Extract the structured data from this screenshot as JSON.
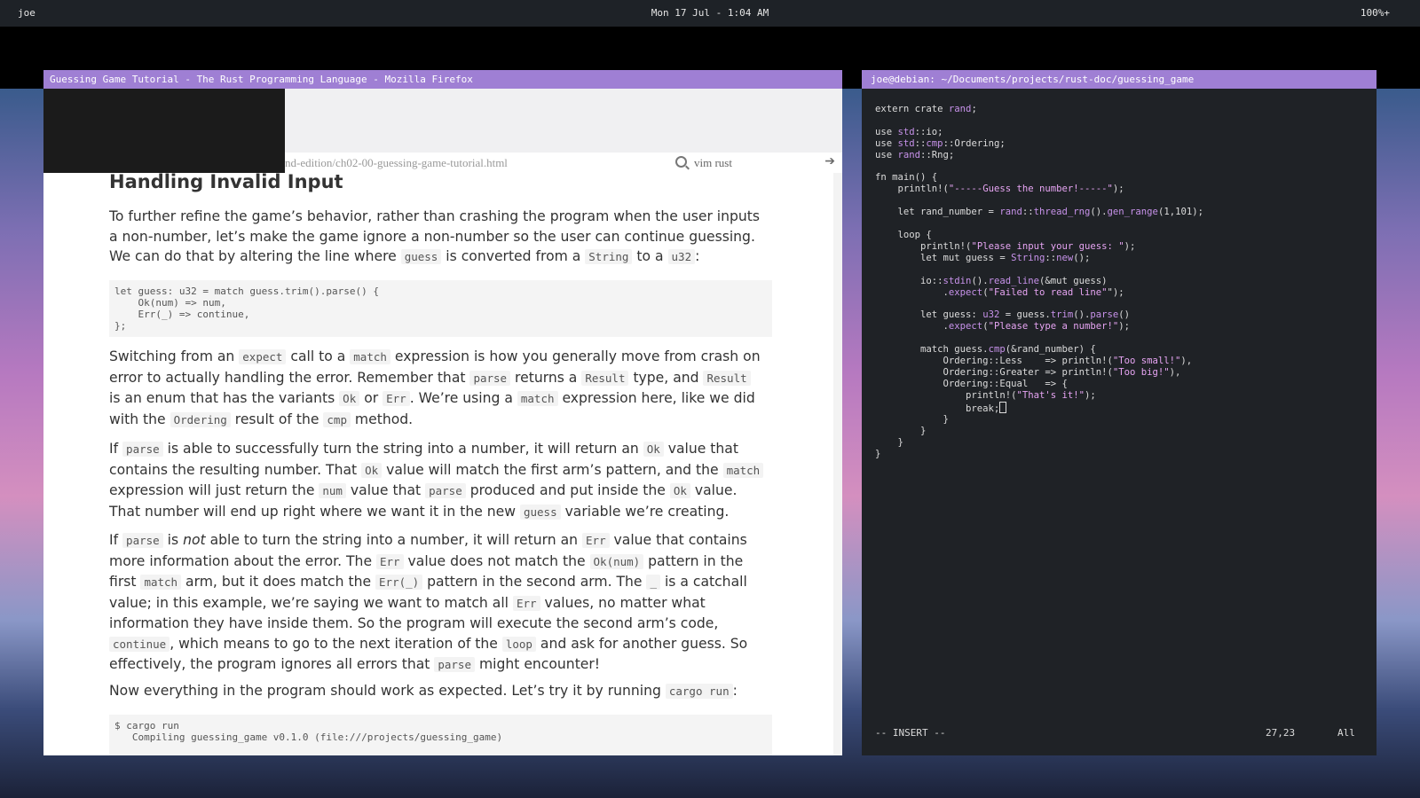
{
  "topbar": {
    "user": "joe",
    "clock": "Mon 17 Jul -  1:04 AM",
    "battery": "100%+"
  },
  "firefox": {
    "title": "Guessing Game Tutorial - The Rust Programming Language - Mozilla Firefox",
    "url_partial": "nd-edition/ch02-00-guessing-game-tutorial.html",
    "search_value": "vim rust",
    "go_glyph": "➔"
  },
  "article": {
    "heading": "Handling Invalid Input",
    "p1": [
      "To further refine the game’s behavior, rather than crashing the program when the user inputs a non-number, let’s make the game ignore a non-number so the user can continue guessing. We can do that by altering the line where ",
      "guess",
      " is converted from a ",
      "String",
      " to a ",
      "u32",
      ":"
    ],
    "code1": [
      "let guess: u32 = match guess.trim().parse() {",
      "    Ok(num) => num,",
      "    Err(_) => continue,",
      "};"
    ],
    "p2": [
      "Switching from an ",
      "expect",
      " call to a ",
      "match",
      " expression is how you generally move from crash on error to actually handling the error. Remember that ",
      "parse",
      " returns a ",
      "Result",
      " type, and ",
      "Result",
      " is an enum that has the variants ",
      "Ok",
      " or ",
      "Err",
      ". We’re using a ",
      "match",
      " expression here, like we did with the ",
      "Ordering",
      " result of the ",
      "cmp",
      " method."
    ],
    "p3": [
      "If ",
      "parse",
      " is able to successfully turn the string into a number, it will return an ",
      "Ok",
      " value that contains the resulting number. That ",
      "Ok",
      " value will match the first arm’s pattern, and the ",
      "match",
      " expression will just return the ",
      "num",
      " value that ",
      "parse",
      " produced and put inside the ",
      "Ok",
      " value. That number will end up right where we want it in the new ",
      "guess",
      " variable we’re creating."
    ],
    "p4": [
      "If ",
      "parse",
      " is ",
      "not",
      " able to turn the string into a number, it will return an ",
      "Err",
      " value that contains more information about the error. The ",
      "Err",
      " value does not match the ",
      "Ok(num)",
      " pattern in the first ",
      "match",
      " arm, but it does match the ",
      "Err(_)",
      " pattern in the second arm. The ",
      "_",
      " is a catchall value; in this example, we’re saying we want to match all ",
      "Err",
      " values, no matter what information they have inside them. So the program will execute the second arm’s code, ",
      "continue",
      ", which means to go to the next iteration of the ",
      "loop",
      " and ask for another guess. So effectively, the program ignores all errors that ",
      "parse",
      " might encounter!"
    ],
    "p5": [
      "Now everything in the program should work as expected. Let’s try it by running ",
      "cargo run",
      ":"
    ],
    "code2": [
      "$ cargo run",
      "   Compiling guessing_game v0.1.0 (file:///projects/guessing_game)"
    ]
  },
  "terminal": {
    "title": "joe@debian: ~/Documents/projects/rust-doc/guessing_game",
    "lines": [
      "extern crate rand;",
      "",
      "use std::io;",
      "use std::cmp::Ordering;",
      "use rand::Rng;",
      "",
      "fn main() {",
      "    println!(\"-----Guess the number!-----\");",
      "",
      "    let rand_number = rand::thread_rng().gen_range(1,101);",
      "",
      "    loop {",
      "        println!(\"Please input your guess: \");",
      "        let mut guess = String::new();",
      "",
      "        io::stdin().read_line(&mut guess)",
      "            .expect(\"Failed to read line\"\");",
      "",
      "        let guess: u32 = guess.trim().parse()",
      "            .expect(\"Please type a number!\");",
      "",
      "        match guess.cmp(&rand_number) {",
      "            Ordering::Less    => println!(\"Too small!\"),",
      "            Ordering::Greater => println!(\"Too big!\"),",
      "            Ordering::Equal   => {",
      "                println!(\"That's it!\");",
      "                break;",
      "            }",
      "        }",
      "    }",
      "}"
    ],
    "mode": "-- INSERT --",
    "position": "27,23",
    "scroll": "All"
  }
}
